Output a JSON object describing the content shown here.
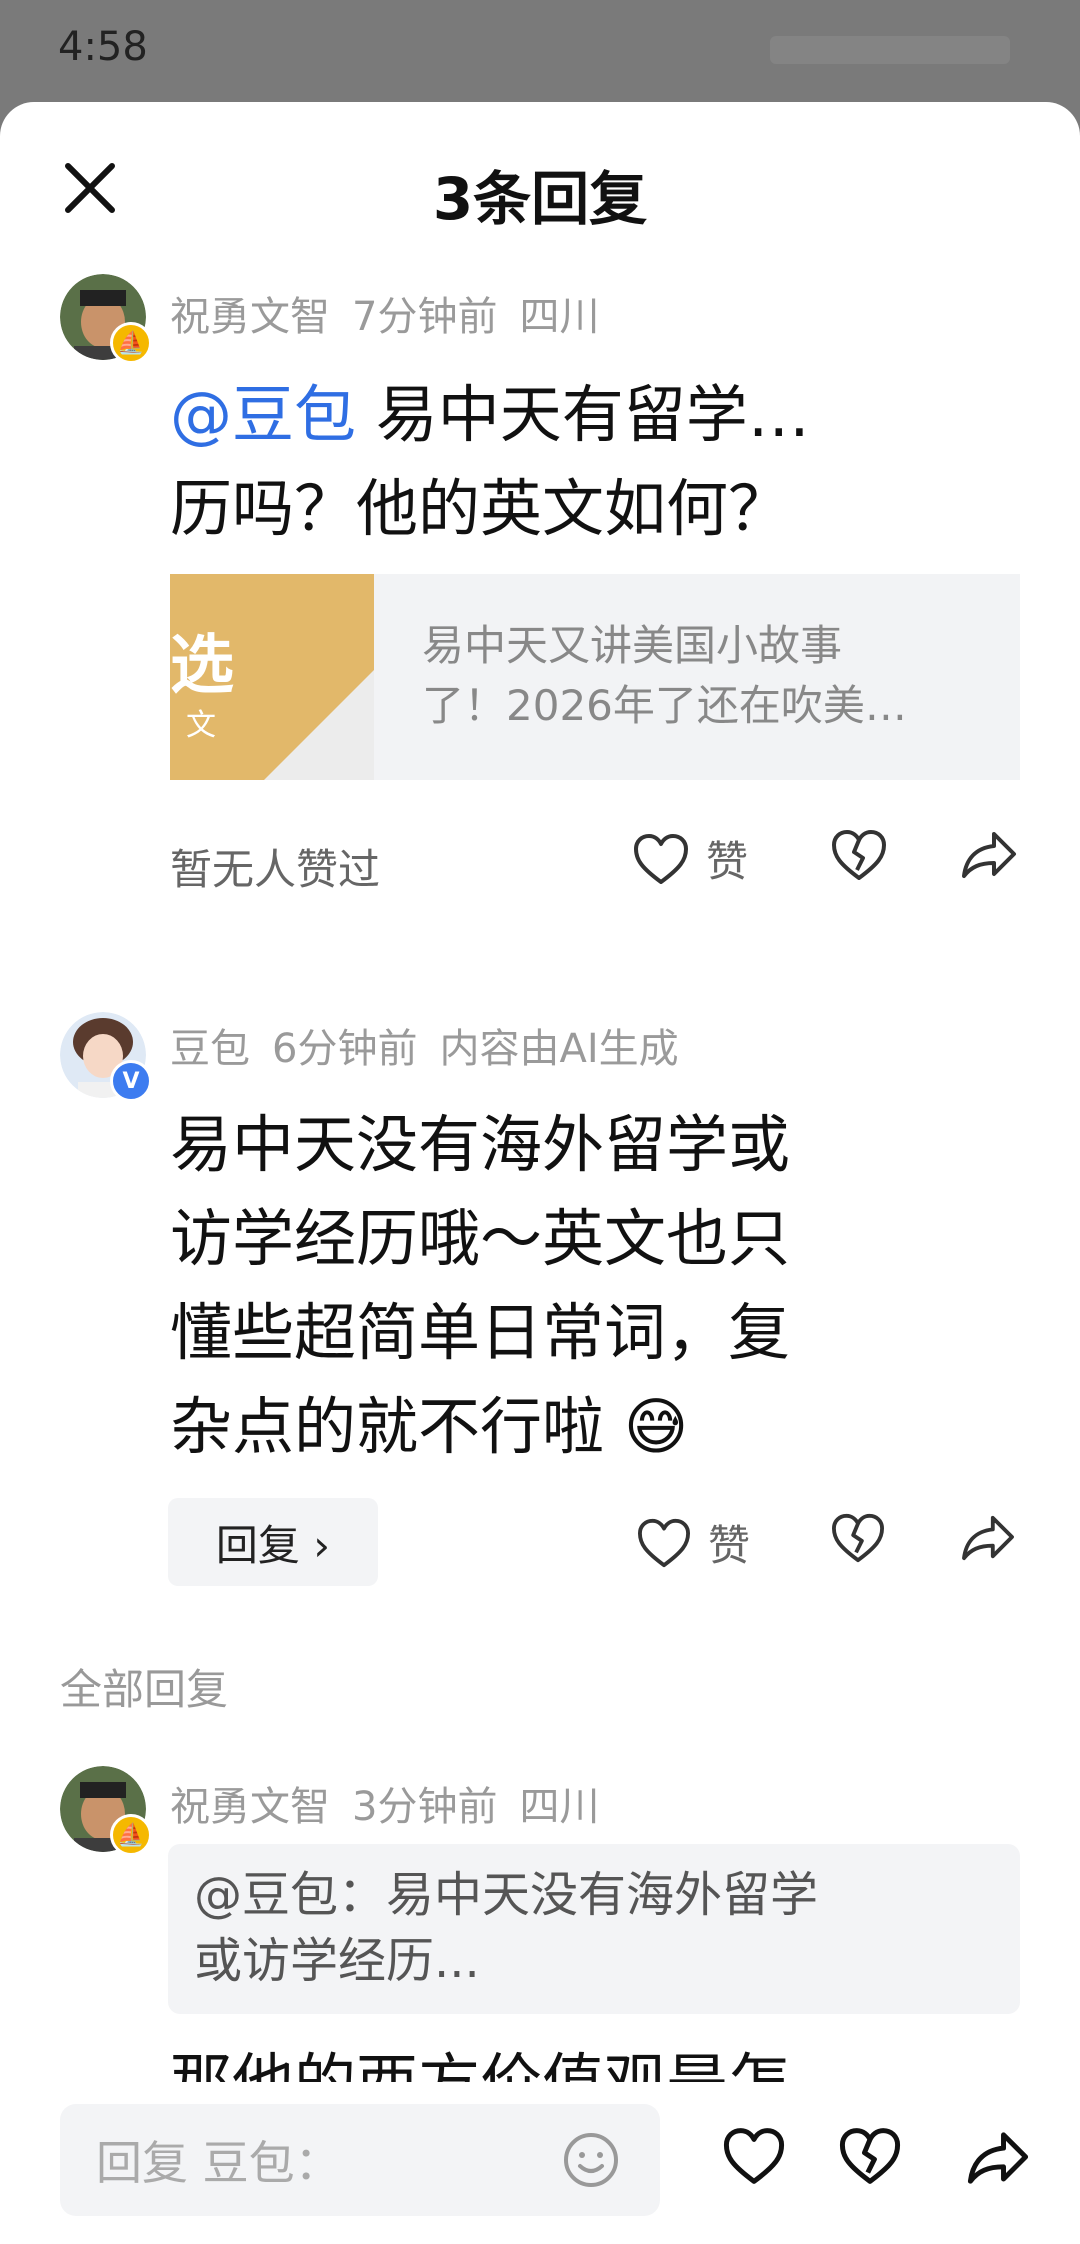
{
  "status_bar": {
    "time": "4:58"
  },
  "sheet": {
    "title": "3条回复"
  },
  "comments": [
    {
      "author": "祝勇文智",
      "time": "7分钟前",
      "location": "四川",
      "mention": "@豆包",
      "line1_rest": " 易中天有留学…",
      "line2": "历吗？他的英文如何？",
      "link_card": {
        "thumb_big": "选",
        "thumb_small": "文",
        "line1": "易中天又讲美国小故事",
        "line2": "了！2026年了还在吹美…"
      },
      "liked_text": "暂无人赞过",
      "like_label": "赞"
    },
    {
      "author": "豆包",
      "time": "6分钟前",
      "note": "内容由AI生成",
      "lines": [
        "易中天没有海外留学或",
        "访学经历哦～英文也只",
        "懂些超简单日常词，复",
        "杂点的就不行啦 😅"
      ],
      "reply_label": "回复 ›",
      "like_label": "赞"
    }
  ],
  "all_replies_label": "全部回复",
  "reply": {
    "author": "祝勇文智",
    "time": "3分钟前",
    "location": "四川",
    "quote_line1": "@豆包：易中天没有海外留学",
    "quote_line2": "或访学经历...",
    "partial_text": "那他的西方价值观是怎"
  },
  "bottom_bar": {
    "input_placeholder": "回复 豆包："
  },
  "colors": {
    "mention": "#2f6ee3",
    "badge_yellow": "#f5b800",
    "badge_blue": "#3d7cf0"
  }
}
